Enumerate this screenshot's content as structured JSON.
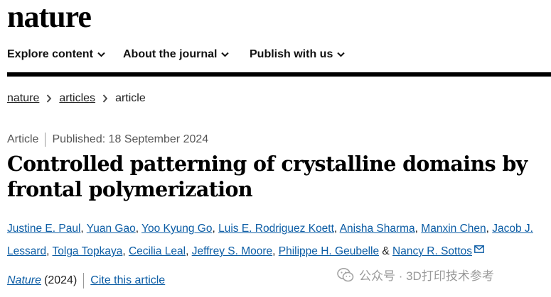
{
  "site": {
    "logo": "nature"
  },
  "nav": {
    "items": [
      {
        "label": "Explore content"
      },
      {
        "label": "About the journal"
      },
      {
        "label": "Publish with us"
      }
    ]
  },
  "breadcrumb": {
    "home": "nature",
    "section": "articles",
    "current": "article"
  },
  "article": {
    "type": "Article",
    "published": "Published: 18 September 2024",
    "title": "Controlled patterning of crystalline domains by frontal polymerization",
    "authors": [
      "Justine E. Paul",
      "Yuan Gao",
      "Yoo Kyung Go",
      "Luis E. Rodriguez Koett",
      "Anisha Sharma",
      "Manxin Chen",
      "Jacob J. Lessard",
      "Tolga Topkaya",
      "Cecilia Leal",
      "Jeffrey S. Moore",
      "Philippe H. Geubelle",
      "Nancy R. Sottos"
    ],
    "author_separator": ",",
    "author_last_separator": "&",
    "journal": "Nature",
    "year": "(2024)",
    "cite_label": "Cite this article"
  },
  "watermark": {
    "text": "公众号 · 3D打印技术参考"
  },
  "colors": {
    "link": "#0c5da5",
    "text": "#222222",
    "rule": "#000000"
  }
}
